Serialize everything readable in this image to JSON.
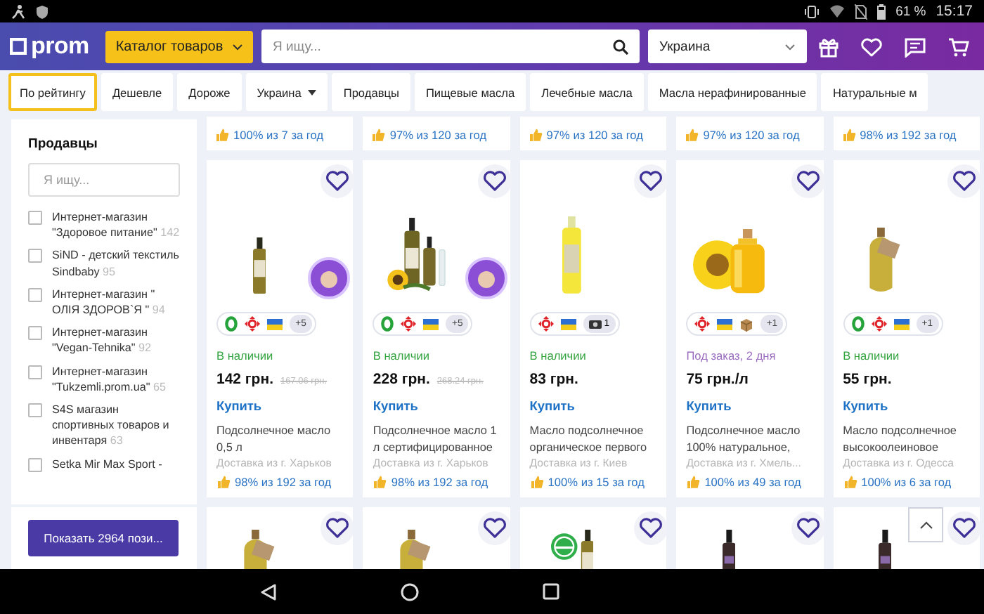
{
  "status_bar": {
    "battery": "61 %",
    "time": "15:17"
  },
  "header": {
    "logo": "prom",
    "catalog_button": "Каталог товаров",
    "search": {
      "placeholder": "Я ищу..."
    },
    "region": "Украина"
  },
  "filters": [
    {
      "label": "По рейтингу",
      "selected": true,
      "kind": "chip"
    },
    {
      "label": "Дешевле",
      "selected": false,
      "kind": "chip"
    },
    {
      "label": "Дороже",
      "selected": false,
      "kind": "chip"
    },
    {
      "label": "Украина",
      "selected": false,
      "kind": "dropdown"
    },
    {
      "label": "Продавцы",
      "selected": false,
      "kind": "chip"
    },
    {
      "label": "Пищевые масла",
      "selected": false,
      "kind": "chip"
    },
    {
      "label": "Лечебные масла",
      "selected": false,
      "kind": "chip"
    },
    {
      "label": "Масла нерафинированные",
      "selected": false,
      "kind": "chip"
    },
    {
      "label": "Натуральные м",
      "selected": false,
      "kind": "chip"
    }
  ],
  "sidebar": {
    "title": "Продавцы",
    "search": {
      "placeholder": "Я ищу..."
    },
    "sellers": [
      {
        "name": "Интернет-магазин \"Здоровое питание\"",
        "count": "142",
        "checked": false
      },
      {
        "name": "SiND - детский текстиль Sindbaby",
        "count": "95",
        "checked": false
      },
      {
        "name": "Интернет-магазин \" ОЛІЯ ЗДОРОВ`Я \"",
        "count": "94",
        "checked": false
      },
      {
        "name": "Интернет-магазин \"Vegan-Tehnika\"",
        "count": "92",
        "checked": false
      },
      {
        "name": "Интернет-магазин \"Tukzemli.prom.ua\"",
        "count": "65",
        "checked": false
      },
      {
        "name": "S4S магазин спортивных товаров и инвентаря",
        "count": "63",
        "checked": false
      },
      {
        "name": "Setka Mir Max Sport -",
        "checked": false
      }
    ],
    "show_button": "Показать 2964 пози..."
  },
  "top_row": [
    {
      "rating": "100% из 7 за год"
    },
    {
      "rating": "97% из 120 за год"
    },
    {
      "rating": "97% из 120 за год"
    },
    {
      "rating": "97% из 120 за год"
    },
    {
      "rating": "98% из 192 за год"
    }
  ],
  "products": [
    {
      "kind": "small_bottle",
      "sticker": true,
      "badges": [
        {
          "kind": "ring"
        },
        {
          "kind": "cross"
        },
        {
          "kind": "flag"
        },
        {
          "kind": "more",
          "text": "+5"
        }
      ],
      "availability": {
        "kind": "in_stock",
        "text": "В наличии"
      },
      "price": "142 грн.",
      "old_price": "167.06 грн.",
      "buy": "Купить",
      "title": "Подсолнечное масло 0,5 л",
      "delivery": "Доставка из г. Харьков",
      "rating": "98% из 192 за год"
    },
    {
      "kind": "bottles_sunflower",
      "sticker": true,
      "badges": [
        {
          "kind": "ring"
        },
        {
          "kind": "cross"
        },
        {
          "kind": "flag"
        },
        {
          "kind": "more",
          "text": "+5"
        }
      ],
      "availability": {
        "kind": "in_stock",
        "text": "В наличии"
      },
      "price": "228 грн.",
      "old_price": "268.24 грн.",
      "buy": "Купить",
      "title": "Подсолнечное масло 1 л сертифицированное",
      "delivery": "Доставка из г. Харьков",
      "rating": "98% из 192 за год"
    },
    {
      "kind": "yellow_bottle",
      "sticker": false,
      "badges": [
        {
          "kind": "cross"
        },
        {
          "kind": "flag"
        },
        {
          "kind": "camera",
          "text": "1"
        }
      ],
      "availability": {
        "kind": "in_stock",
        "text": "В наличии"
      },
      "price": "83 грн.",
      "buy": "Купить",
      "title": "Масло подсолнечное органическое первого",
      "delivery": "Доставка из г. Киев",
      "rating": "100% из 15 за год"
    },
    {
      "kind": "sunflower_jar",
      "sticker": false,
      "badges": [
        {
          "kind": "cross"
        },
        {
          "kind": "flag"
        },
        {
          "kind": "box"
        },
        {
          "kind": "more",
          "text": "+1"
        }
      ],
      "availability": {
        "kind": "on_order",
        "text": "Под заказ, 2 дня"
      },
      "price": "75 грн./л",
      "buy": "Купить",
      "title": "Подсолнечное масло 100% натуральное,",
      "delivery": "Доставка из г. Хмель...",
      "rating": "100% из 49 за год"
    },
    {
      "kind": "tagged_jar",
      "sticker": false,
      "badges": [
        {
          "kind": "ring"
        },
        {
          "kind": "cross"
        },
        {
          "kind": "flag"
        },
        {
          "kind": "more",
          "text": "+1"
        }
      ],
      "availability": {
        "kind": "in_stock",
        "text": "В наличии"
      },
      "price": "55 грн.",
      "buy": "Купить",
      "title": "Масло подсолнечное высокоолеиновое",
      "delivery": "Доставка из г. Одесса",
      "rating": "100% из 6 за год"
    }
  ],
  "bottom_row": [
    {
      "kind": "tagged_jar",
      "seal": false
    },
    {
      "kind": "tagged_jar",
      "seal": false
    },
    {
      "kind": "small_bottle",
      "seal": true
    },
    {
      "kind": "dark_bottle",
      "seal": false
    },
    {
      "kind": "dark_bottle",
      "seal": false
    }
  ]
}
